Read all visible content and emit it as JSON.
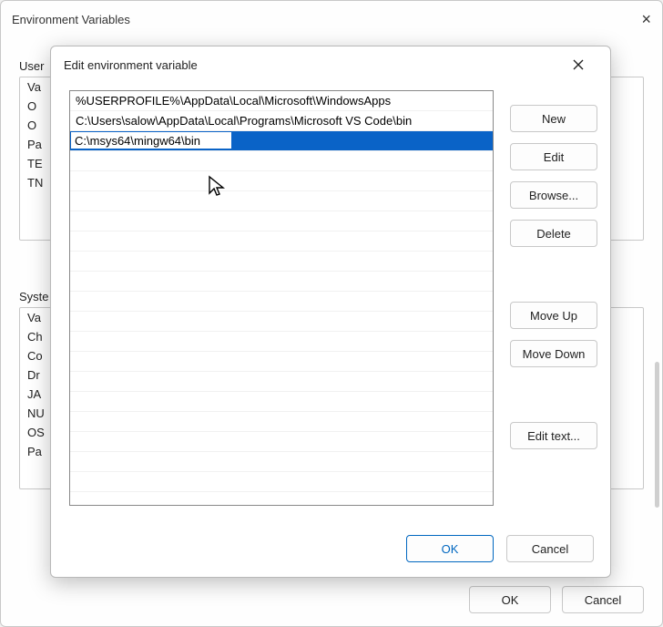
{
  "parent": {
    "title": "Environment Variables",
    "user_section_label": "User",
    "user_vars": [
      "Va",
      "O",
      "O",
      "Pa",
      "TE",
      "TN"
    ],
    "system_section_label": "Syste",
    "system_vars": [
      "Va",
      "Ch",
      "Co",
      "Dr",
      "JA",
      "NU",
      "OS",
      "Pa"
    ],
    "ok_label": "OK",
    "cancel_label": "Cancel"
  },
  "modal": {
    "title": "Edit environment variable",
    "entries": [
      "%USERPROFILE%\\AppData\\Local\\Microsoft\\WindowsApps",
      "C:\\Users\\salow\\AppData\\Local\\Programs\\Microsoft VS Code\\bin",
      "C:\\msys64\\mingw64\\bin"
    ],
    "editing_index": 2,
    "buttons": {
      "new": "New",
      "edit": "Edit",
      "browse": "Browse...",
      "delete": "Delete",
      "moveup": "Move Up",
      "movedown": "Move Down",
      "edittext": "Edit text..."
    },
    "ok_label": "OK",
    "cancel_label": "Cancel"
  }
}
